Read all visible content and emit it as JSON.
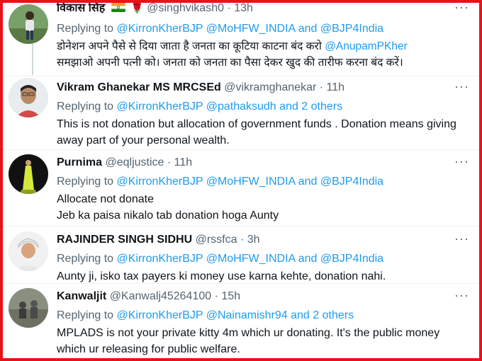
{
  "tweets": [
    {
      "name": "विकास सिंह",
      "handle": "@singhvikash0",
      "time": "13h",
      "reply_prefix": "Replying to",
      "mentions": "@KirronKherBJP @MoHFW_INDIA and @BJP4India",
      "text_line1_a": "डोनेशन अपने पैसे से दिया जाता है जनता का कूटिया काटना बंद करो ",
      "text_line1_link": "@AnupamPKher",
      "text_line2": "समझाओ अपनी पत्नी को। जनता को जनता का पैसा देकर खुद की तारीफ करना बंद करें।"
    },
    {
      "name": "Vikram Ghanekar MS MRCSEd",
      "handle": "@vikramghanekar",
      "time": "11h",
      "reply_prefix": "Replying to",
      "mentions": "@KirronKherBJP @pathaksudh and 2 others",
      "text": "This is not donation but allocation of government funds . Donation means giving away part of your personal wealth."
    },
    {
      "name": "Purnima",
      "handle": "@eqljustice",
      "time": "11h",
      "reply_prefix": "Replying to",
      "mentions": "@KirronKherBJP @MoHFW_INDIA and @BJP4India",
      "text_line1": "Allocate not donate",
      "text_line2": "Jeb ka paisa nikalo tab donation hoga Aunty"
    },
    {
      "name": "RAJINDER SINGH SIDHU",
      "handle": "@rssfca",
      "time": "3h",
      "reply_prefix": "Replying to",
      "mentions": "@KirronKherBJP @MoHFW_INDIA and @BJP4India",
      "text": "Aunty ji, isko tax payers ki money use karna kehte, donation nahi."
    },
    {
      "name": "Kanwaljit",
      "handle": "@Kanwalj45264100",
      "time": "15h",
      "reply_prefix": "Replying to",
      "mentions": "@KirronKherBJP @Nainamishr94 and 2 others",
      "text": "MPLADS is not your private kitty 4m which ur donating. It's the public money which ur releasing for public welfare."
    }
  ],
  "separator": "·",
  "more_icon": "more-horizontal-icon",
  "colors": {
    "accent": "#1d9bf0",
    "frame": "#e8121a",
    "secondary_text": "#536471"
  }
}
